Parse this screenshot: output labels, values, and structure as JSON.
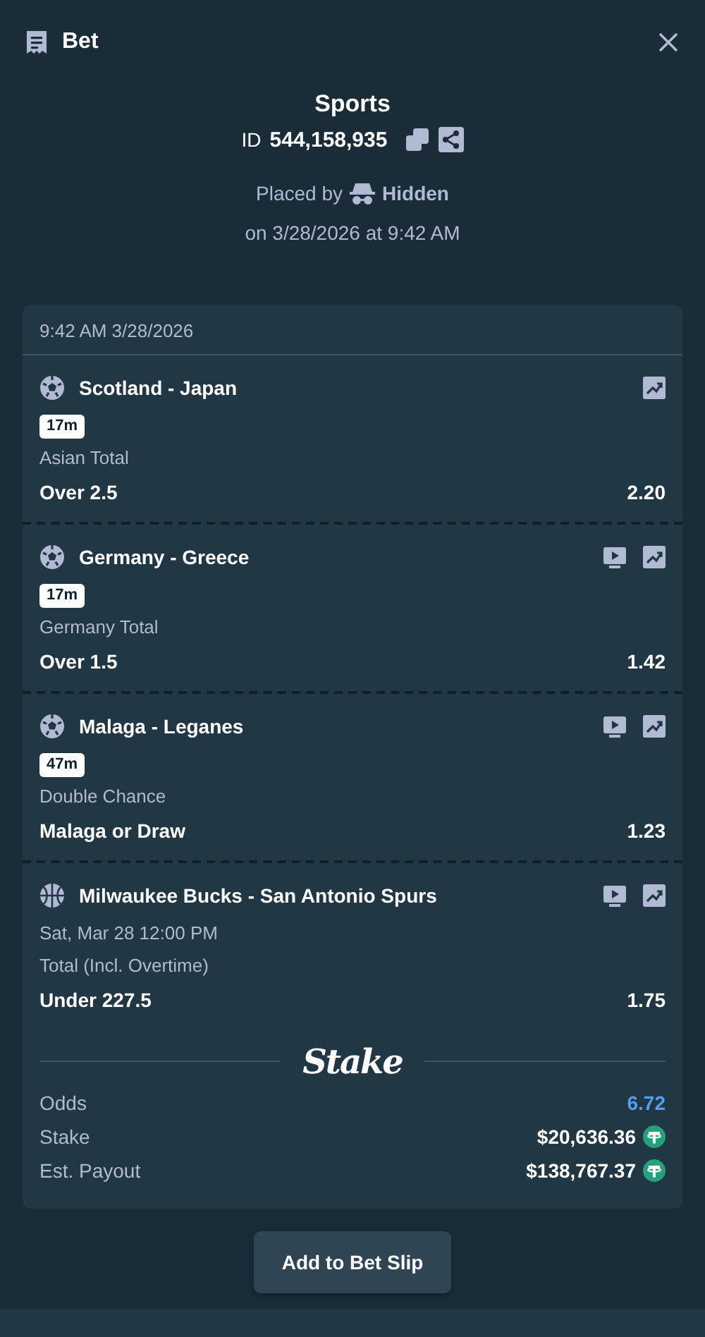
{
  "header": {
    "title": "Bet"
  },
  "summary": {
    "category": "Sports",
    "id_label": "ID",
    "id_value": "544,158,935",
    "placed_by_label": "Placed by",
    "placed_by_user": "Hidden",
    "placed_on": "on 3/28/2026 at 9:42 AM"
  },
  "slip": {
    "timestamp": "9:42 AM 3/28/2026",
    "legs": [
      {
        "kind": "soccer",
        "event": "Scotland - Japan",
        "stream": false,
        "badge": "17m",
        "market": "Asian Total",
        "selection": "Over 2.5",
        "odds": "2.20"
      },
      {
        "kind": "soccer",
        "event": "Germany - Greece",
        "stream": true,
        "badge": "17m",
        "market": "Germany Total",
        "selection": "Over 1.5",
        "odds": "1.42"
      },
      {
        "kind": "soccer",
        "event": "Malaga - Leganes",
        "stream": true,
        "badge": "47m",
        "market": "Double Chance",
        "selection": "Malaga or Draw",
        "odds": "1.23"
      },
      {
        "kind": "basketball",
        "event": "Milwaukee Bucks - San Antonio Spurs",
        "stream": true,
        "start_time": "Sat, Mar 28  12:00 PM",
        "market": "Total (Incl. Overtime)",
        "selection": "Under 227.5",
        "odds": "1.75"
      }
    ],
    "brand": "Stake",
    "totals": [
      {
        "label": "Odds",
        "value": "6.72",
        "kind": "odds"
      },
      {
        "label": "Stake",
        "value": "$20,636.36",
        "kind": "currency"
      },
      {
        "label": "Est. Payout",
        "value": "$138,767.37",
        "kind": "currency"
      }
    ]
  },
  "action_button": "Add to Bet Slip"
}
